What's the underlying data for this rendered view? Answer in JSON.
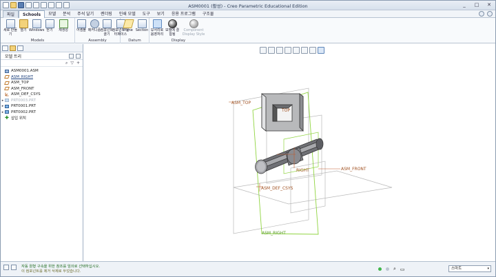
{
  "window": {
    "title": "ASM0001 (활성) - Creo Parametric Educational Edition",
    "controls": [
      "_",
      "□",
      "✕"
    ]
  },
  "menu": {
    "tabs": [
      "파일",
      "Schools",
      "모델",
      "분석",
      "주석 달기",
      "렌더링",
      "인쇄 모델",
      "도구",
      "보기",
      "응용 프로그램",
      "구조물"
    ]
  },
  "ribbon": {
    "groups": [
      {
        "label": "Models",
        "buttons": [
          "새로 만들기",
          "열기",
          "Windows",
          "닫기",
          "재생성"
        ]
      },
      {
        "label": "Assembly",
        "buttons": [
          "어셈블",
          "메커니즘",
          "컴포넌트 끌기",
          "컴포넌트 인터페이스"
        ]
      },
      {
        "label": "Datum",
        "buttons": [
          "Plane",
          "Section"
        ]
      },
      {
        "label": "Display",
        "buttons": [
          "모서리로 음영처리",
          "모델에 결합됨",
          "Component Display Style"
        ]
      }
    ]
  },
  "model_tree": {
    "header": "모델 트리",
    "items": [
      {
        "label": "ASM0001.ASM",
        "icon": "assembly-icon",
        "expander": ""
      },
      {
        "label": "ASM_RIGHT",
        "icon": "datum-plane-icon",
        "expander": ""
      },
      {
        "label": "ASM_TOP",
        "icon": "datum-plane-icon",
        "expander": ""
      },
      {
        "label": "ASM_FRONT",
        "icon": "datum-plane-icon",
        "expander": ""
      },
      {
        "label": "ASM_DEF_CSYS",
        "icon": "csys-icon",
        "expander": ""
      },
      {
        "label": "PRT0003.PRT",
        "icon": "part-icon",
        "expander": "▸"
      },
      {
        "label": "PRT0001.PRT",
        "icon": "part-icon",
        "expander": "▸"
      },
      {
        "label": "PRT0002.PRT",
        "icon": "part-icon",
        "expander": "▸"
      },
      {
        "label": "삽입 위치",
        "icon": "insert-here-icon",
        "expander": ""
      }
    ]
  },
  "graphics": {
    "datum_labels": {
      "asm_top": "ASM_TOP",
      "asm_front": "ASM_FRONT",
      "asm_def_csys": "ASM_DEF_CSYS",
      "asm_right": "ASM_RIGHT",
      "top": "TOP",
      "right": "RIGHT"
    }
  },
  "status": {
    "message_1": "자동 원형 구속을 위한 참조를 임의로 선택하십시오.",
    "message_2": "이 컴포넌트를 제거 삭제로 두었습니다.",
    "filter": "스마트",
    "caret": "▾",
    "icons": [
      "filter-icon",
      "toggle-icon"
    ]
  }
}
